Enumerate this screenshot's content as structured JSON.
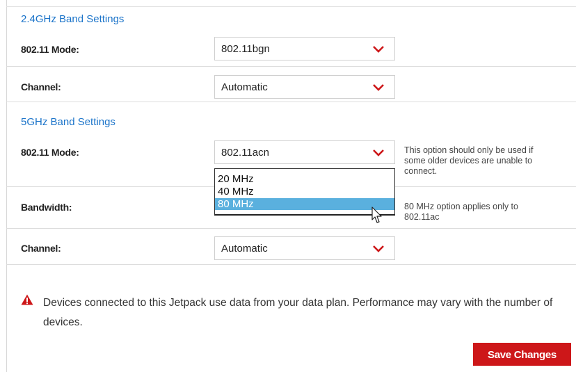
{
  "band24": {
    "title": "2.4GHz Band Settings",
    "mode_label": "802.11 Mode:",
    "mode_value": "802.11bgn",
    "channel_label": "Channel:",
    "channel_value": "Automatic"
  },
  "band5": {
    "title": "5GHz Band Settings",
    "mode_label": "802.11 Mode:",
    "mode_value": "802.11acn",
    "mode_help": [
      "This option should only be used if",
      "some older devices are unable to",
      "connect."
    ],
    "bandwidth_label": "Bandwidth:",
    "bandwidth_options": [
      "20 MHz",
      "40 MHz",
      "80 MHz"
    ],
    "bandwidth_selected": "80 MHz",
    "bandwidth_help": [
      "80 MHz option applies only to",
      "802.11ac"
    ],
    "channel_label": "Channel:",
    "channel_value": "Automatic"
  },
  "notice": {
    "text": "Devices connected to this Jetpack use data from your data plan. Performance may vary with the number of devices.",
    "icon": "warning-triangle-icon"
  },
  "actions": {
    "save_label": "Save Changes"
  },
  "colors": {
    "accent_red": "#cd1719",
    "link_blue": "#1a73c9",
    "selected_option": "#5ab0de"
  }
}
